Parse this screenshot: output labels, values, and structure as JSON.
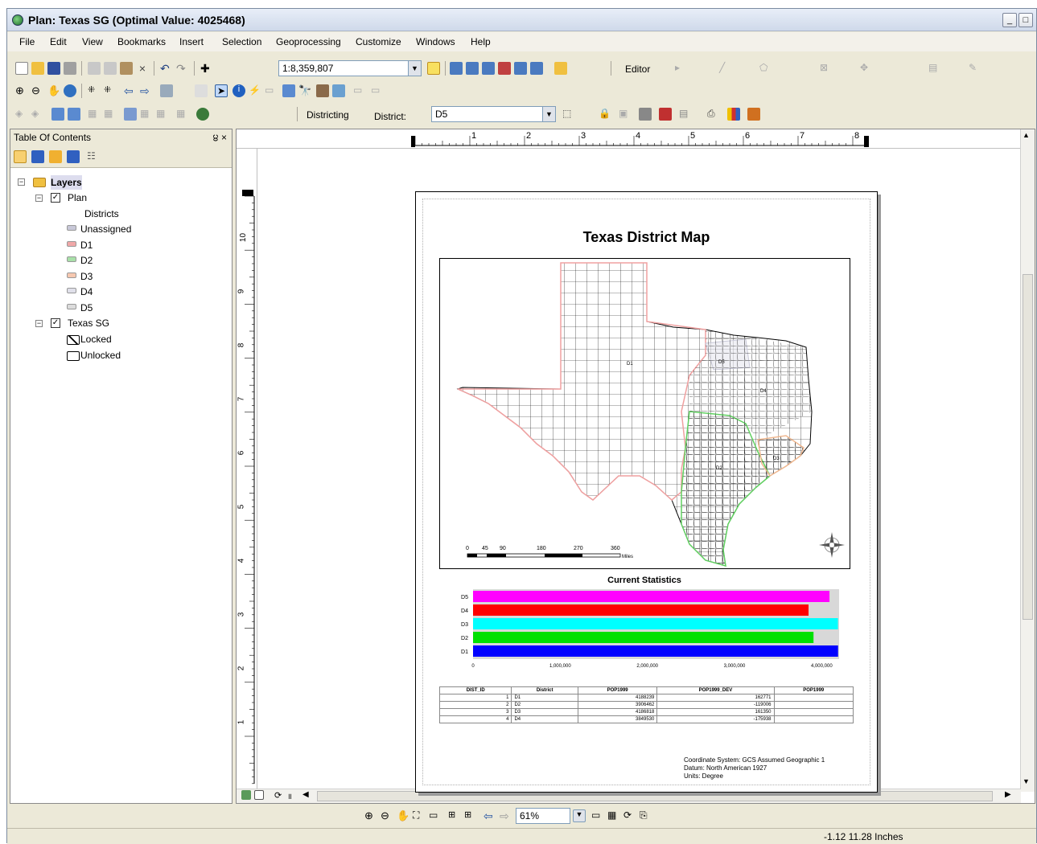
{
  "window": {
    "title": "Plan:  Texas SG     (Optimal Value: 4025468)"
  },
  "menu": [
    "File",
    "Edit",
    "View",
    "Bookmarks",
    "Insert",
    "Selection",
    "Geoprocessing",
    "Customize",
    "Windows",
    "Help"
  ],
  "toolbar": {
    "scale_value": "1:8,359,807",
    "editor_label": "Editor",
    "districting_label": "Districting",
    "district_label": "District:",
    "district_value": "D5"
  },
  "toc": {
    "title": "Table Of Contents",
    "pin": "੪ ×",
    "root": "Layers",
    "plan_layer": "Plan",
    "districts_header": "Districts",
    "district_items": [
      {
        "label": "Unassigned",
        "color": "#c8c8d8"
      },
      {
        "label": "D1",
        "color": "#f0a8a8"
      },
      {
        "label": "D2",
        "color": "#a8e0a8"
      },
      {
        "label": "D3",
        "color": "#f6c8b0"
      },
      {
        "label": "D4",
        "color": "#e0e0ea"
      },
      {
        "label": "D5",
        "color": "#dcdcdc"
      }
    ],
    "texas_layer": "Texas SG",
    "texas_items": [
      "Locked",
      "Unlocked"
    ]
  },
  "layout": {
    "ruler_h": [
      "1",
      "2",
      "3",
      "4",
      "5",
      "6",
      "7",
      "8"
    ],
    "ruler_v": [
      "10",
      "9",
      "8",
      "7",
      "6",
      "5",
      "4",
      "3",
      "2",
      "1"
    ],
    "map_title": "Texas District Map",
    "scale_bar_labels": [
      "0",
      "45",
      "90",
      "180",
      "270",
      "360"
    ],
    "scale_bar_unit": "Miles",
    "district_labels": [
      "D1",
      "D5",
      "D4",
      "D2",
      "D3"
    ],
    "chart_title": "Current Statistics",
    "coordinate_text": [
      "Coordinate System: GCS Assumed Geographic 1",
      "Datum: North American 1927",
      "Units: Degree"
    ]
  },
  "chart_data": {
    "type": "bar",
    "orientation": "horizontal",
    "title": "Current Statistics",
    "categories": [
      "D5",
      "D4",
      "D3",
      "D2",
      "D1"
    ],
    "values": [
      4090000,
      3849530,
      4186818,
      3906462,
      4188239
    ],
    "colors": [
      "#ff00ff",
      "#ff0000",
      "#00ffff",
      "#00e000",
      "#0000ff"
    ],
    "xlim": [
      0,
      4200000
    ],
    "xticks": [
      "0",
      "1,000,000",
      "2,000,000",
      "3,000,000",
      "4,000,000"
    ],
    "grid": false
  },
  "table": {
    "headers": [
      "DIST_ID",
      "District",
      "POP1999",
      "POP1999_DEV",
      "POP1999"
    ],
    "rows": [
      [
        "1",
        "D1",
        "4188239",
        "162771",
        ""
      ],
      [
        "2",
        "D2",
        "3906462",
        "-119006",
        ""
      ],
      [
        "3",
        "D3",
        "4186818",
        "161350",
        ""
      ],
      [
        "4",
        "D4",
        "3849530",
        "-175938",
        ""
      ]
    ]
  },
  "bottom_toolbar": {
    "zoom_value": "61%"
  },
  "status": {
    "coords": "-1.12  11.28 Inches"
  }
}
